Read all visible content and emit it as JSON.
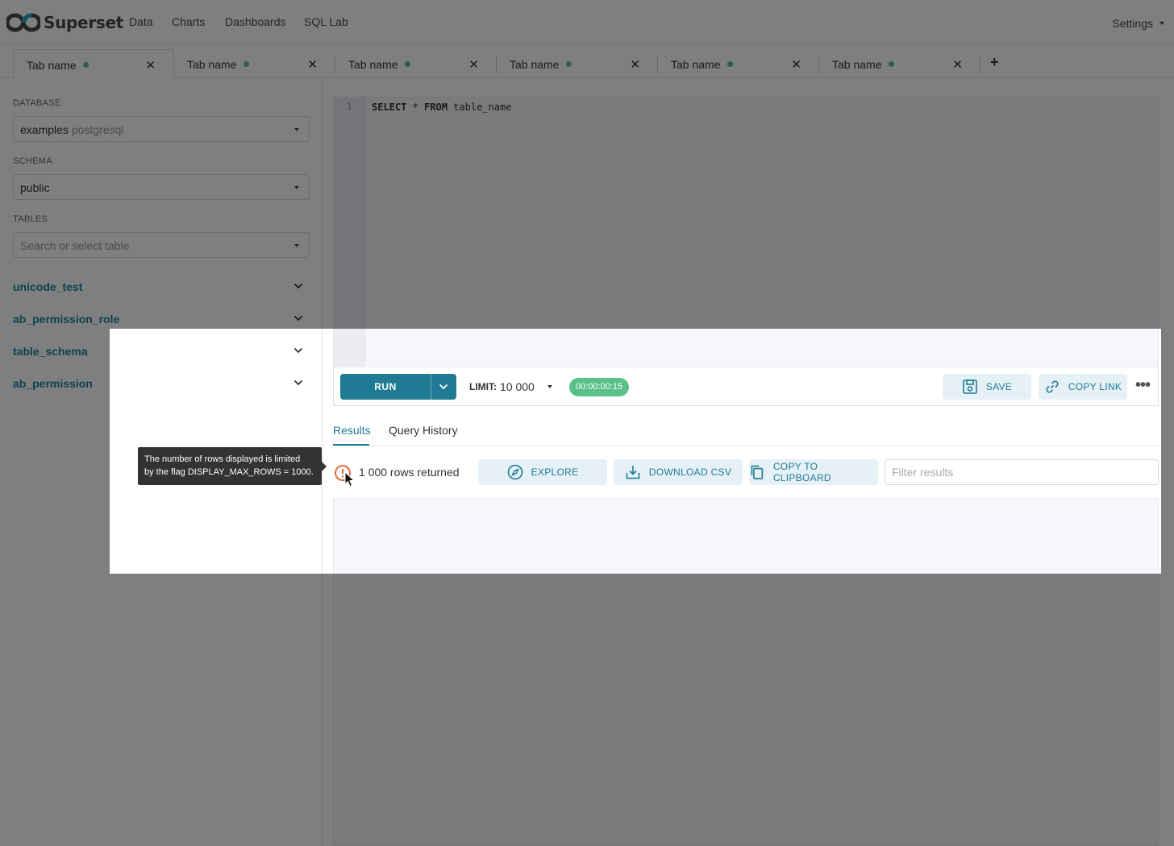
{
  "navbar": {
    "brand": "Superset",
    "items": [
      "Data",
      "Charts",
      "Dashboards",
      "SQL Lab"
    ],
    "settings_label": "Settings"
  },
  "tabs": {
    "items": [
      {
        "label": "Tab name"
      },
      {
        "label": "Tab name"
      },
      {
        "label": "Tab name"
      },
      {
        "label": "Tab name"
      },
      {
        "label": "Tab name"
      },
      {
        "label": "Tab name"
      }
    ],
    "close_glyph": "✕",
    "add_glyph": "+"
  },
  "sidebar": {
    "database_label": "DATABASE",
    "database_name": "examples",
    "database_engine": "postgresql",
    "schema_label": "SCHEMA",
    "schema_value": "public",
    "tables_label": "TABLES",
    "tables_placeholder": "Search or select table",
    "tables": [
      "unicode_test",
      "ab_permission_role",
      "table_schema",
      "ab_permission"
    ]
  },
  "editor": {
    "line_number": "1",
    "code_select": "SELECT",
    "code_star": " * ",
    "code_from": "FROM",
    "code_table": " table_name"
  },
  "toolbar": {
    "run_label": "RUN",
    "limit_label": "LIMIT:",
    "limit_value": "10 000",
    "timer": "00:00:00:15",
    "save_label": "SAVE",
    "copy_link_label": "COPY LINK",
    "more_glyph": "•••"
  },
  "results": {
    "tab_results": "Results",
    "tab_history": "Query History",
    "rows_returned": "1 000 rows returned",
    "explore_label": "EXPLORE",
    "download_label": "DOWNLOAD CSV",
    "clipboard_label": "COPY TO CLIPBOARD",
    "filter_placeholder": "Filter results",
    "tooltip_line1": "The number of rows displayed is limited",
    "tooltip_line2": "by the flag DISPLAY_MAX_ROWS = 1000."
  },
  "colors": {
    "accent": "#1f7a94",
    "success": "#5ac189",
    "warning": "#e86b3a"
  }
}
